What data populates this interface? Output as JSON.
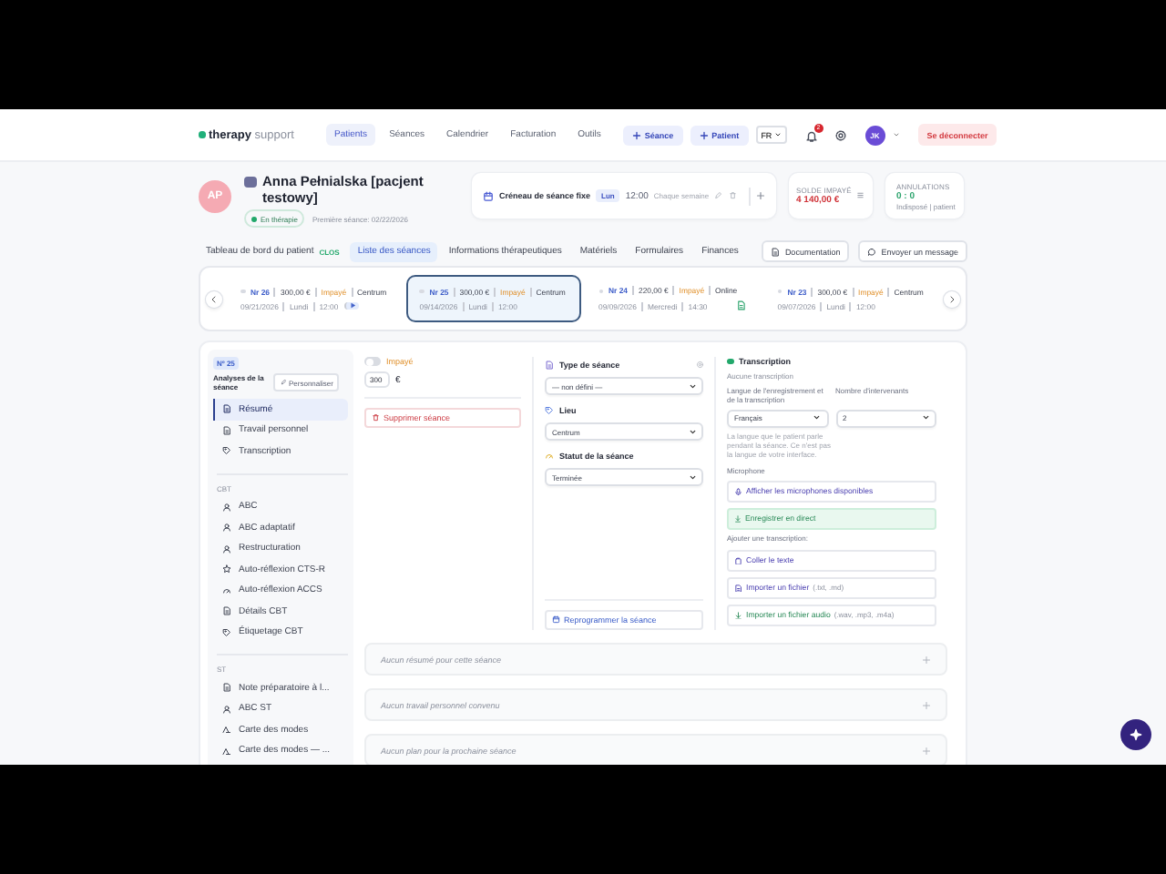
{
  "nav": {
    "logo": "**therapy** support",
    "items": [
      {
        "label": "Patients",
        "selected": true
      },
      {
        "label": "Séances",
        "selected": false
      },
      {
        "label": "Calendrier",
        "selected": false
      },
      {
        "label": "Facturation",
        "selected": false
      },
      {
        "label": "Outils",
        "selected": false
      }
    ],
    "buttons": [
      "Séance",
      "Patient"
    ],
    "language": "FR",
    "notifications": "2",
    "avatar": "JK",
    "logout": "Se déconnecter"
  },
  "patient": {
    "initials": "AP",
    "name": "Anna Pełnialska [pacjent testowy]",
    "status": "En thérapie",
    "first_session": "Première séance: 02/22/2026"
  },
  "slot": {
    "title": "Créneau de séance fixe",
    "day": "Lun",
    "time": "12:00",
    "repeat": "Chaque semaine"
  },
  "balance": {
    "label": "SOLDE IMPAYÉ",
    "amount": "4 140,00 €"
  },
  "cancellations": {
    "label": "ANNULATIONS",
    "value": "0 : 0",
    "caption": "Indisposé | patient"
  },
  "tabs": [
    {
      "label": "Tableau de bord du patient",
      "badge": "CLOS",
      "selected": false
    },
    {
      "label": "Liste des séances",
      "selected": true
    },
    {
      "label": "Informations thérapeutiques",
      "selected": false
    },
    {
      "label": "Matériels",
      "selected": false
    },
    {
      "label": "Formulaires",
      "selected": false
    },
    {
      "label": "Finances",
      "selected": false
    }
  ],
  "actions": [
    "Documentation",
    "Envoyer un message"
  ],
  "sessions": [
    {
      "number": "Nr 26",
      "amount": "300,00 €",
      "payment": "Impayé",
      "place": "Centrum",
      "date": "09/21/2026",
      "day": "Lundi",
      "time": "12:00",
      "kind": "play",
      "selected": false
    },
    {
      "number": "Nr 25",
      "amount": "300,00 €",
      "payment": "Impayé",
      "place": "Centrum",
      "date": "09/14/2026",
      "day": "Lundi",
      "time": "12:00",
      "kind": "plain",
      "selected": true
    },
    {
      "number": "Nr 24",
      "amount": "220,00 €",
      "payment": "Impayé",
      "place": "Online",
      "date": "09/09/2026",
      "day": "Mercredi",
      "time": "14:30",
      "kind": "document",
      "selected": false
    },
    {
      "number": "Nr 23",
      "amount": "300,00 €",
      "payment": "Impayé",
      "place": "Centrum",
      "date": "09/07/2026",
      "day": "Lundi",
      "time": "12:00",
      "kind": "plain",
      "selected": false
    }
  ],
  "detail": {
    "number": "Nº 25",
    "title": "Analyses de la séance",
    "customize": "Personnaliser",
    "groups": [
      {
        "items": [
          {
            "label": "Résumé",
            "kind": "document",
            "selected": true
          },
          {
            "label": "Travail personnel",
            "kind": "document",
            "selected": false
          },
          {
            "label": "Transcription",
            "kind": "tag",
            "selected": false
          }
        ]
      },
      {
        "heading": "CBT",
        "items": [
          {
            "label": "ABC",
            "kind": "people",
            "selected": false
          },
          {
            "label": "ABC adaptatif",
            "kind": "people",
            "selected": false
          },
          {
            "label": "Restructuration",
            "kind": "people",
            "selected": false
          },
          {
            "label": "Auto-réflexion CTS-R",
            "kind": "star",
            "selected": false
          },
          {
            "label": "Auto-réflexion ACCS",
            "kind": "gauge",
            "selected": false
          },
          {
            "label": "Détails CBT",
            "kind": "document",
            "selected": false
          },
          {
            "label": "Étiquetage CBT",
            "kind": "tag",
            "selected": false
          }
        ]
      },
      {
        "heading": "ST",
        "items": [
          {
            "label": "Note préparatoire à l...",
            "kind": "document",
            "selected": false
          },
          {
            "label": "ABC ST",
            "kind": "people",
            "selected": false
          },
          {
            "label": "Carte des modes",
            "kind": "map",
            "selected": false
          },
          {
            "label": "Carte des modes — ...",
            "kind": "map",
            "selected": false
          }
        ]
      }
    ]
  },
  "payment": {
    "label": "Impayé",
    "paid": false,
    "amount": "300",
    "currency": "€",
    "delete": "Supprimer séance"
  },
  "fields": [
    {
      "label": "Type de séance",
      "value": "— non défini —",
      "kind": "type"
    },
    {
      "label": "Lieu",
      "value": "Centrum",
      "kind": "place"
    },
    {
      "label": "Statut de la séance",
      "value": "Terminée",
      "kind": "status"
    }
  ],
  "reschedule": "Reprogrammer la séance",
  "transcription": {
    "title": "Transcription",
    "empty": "Aucune transcription",
    "language_label": "Langue de l'enregistrement et de la transcription",
    "language": "Français",
    "speakers_label": "Nombre d'intervenants",
    "speakers": "2",
    "help": "La langue que le patient parle pendant la séance. Ce n'est pas la langue de votre interface.",
    "microphone_label": "Microphone",
    "show_mics": "Afficher les microphones disponibles",
    "record": "Enregistrer en direct",
    "add_label": "Ajouter une transcription:",
    "add_options": [
      {
        "label": "Coller le texte",
        "kind": "paste"
      },
      {
        "label": "Importer un fichier",
        "hint": "(.txt, .md)",
        "kind": "file"
      },
      {
        "label": "Importer un fichier audio",
        "hint": "(.wav, .mp3, .m4a)",
        "kind": "audio"
      }
    ]
  },
  "notes": [
    "Aucun résumé pour cette séance",
    "Aucun travail personnel convenu",
    "Aucun plan pour la prochaine séance"
  ]
}
